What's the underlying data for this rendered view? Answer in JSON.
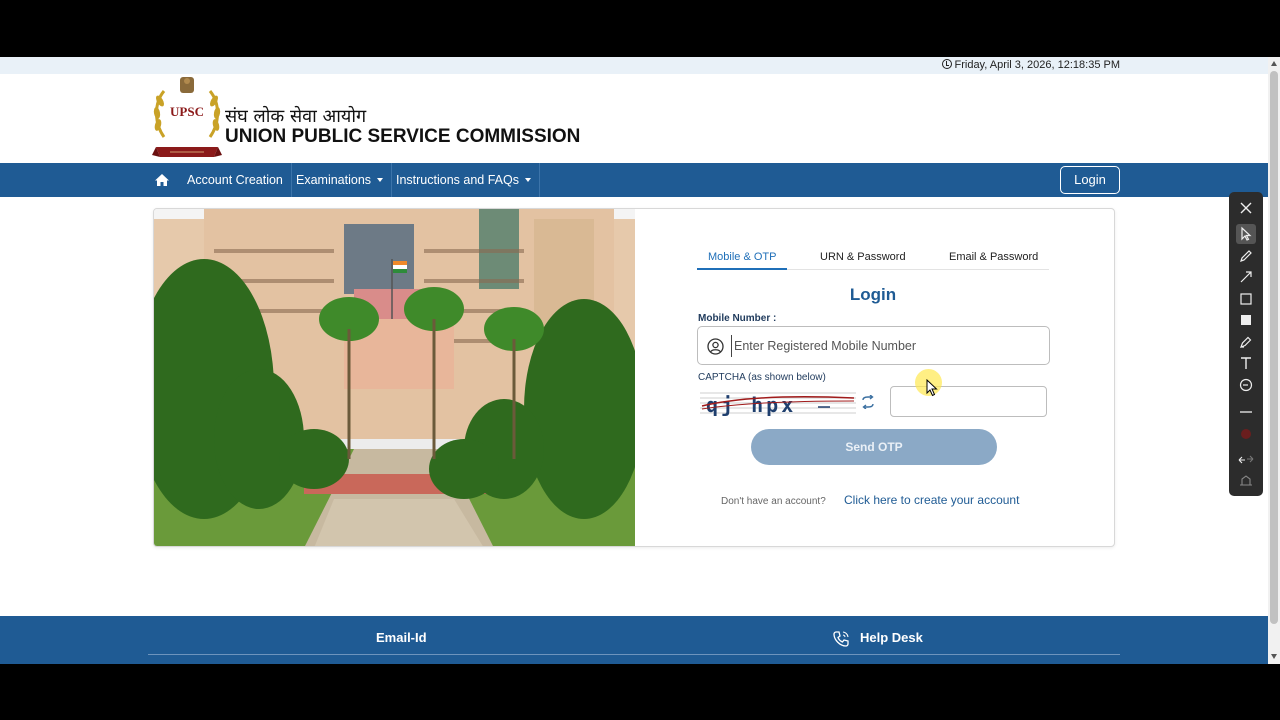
{
  "datetime": "Friday, April 3, 2026, 12:18:35 PM",
  "brand": {
    "emblem_text": "UPSC",
    "hindi_name": "संघ लोक सेवा आयोग",
    "english_name": "UNION PUBLIC SERVICE COMMISSION"
  },
  "nav": {
    "items": [
      {
        "label": "Account Creation"
      },
      {
        "label": "Examinations"
      },
      {
        "label": "Instructions and FAQs"
      }
    ],
    "login_label": "Login"
  },
  "login": {
    "tabs": [
      {
        "label": "Mobile & OTP",
        "active": true
      },
      {
        "label": "URN & Password",
        "active": false
      },
      {
        "label": "Email & Password",
        "active": false
      }
    ],
    "title": "Login",
    "mobile_label": "Mobile Number :",
    "mobile_placeholder": "Enter Registered Mobile Number",
    "captcha_label": "CAPTCHA (as shown below)",
    "captcha_text": "qj hpx",
    "send_otp_label": "Send OTP",
    "no_account_text": "Don't have an account?",
    "create_account_link": "Click here to create your account"
  },
  "footer": {
    "email_label": "Email-Id",
    "helpdesk_label": "Help Desk"
  },
  "colors": {
    "nav_blue": "#1f5b94",
    "button_disabled": "#8ba9c6",
    "link_blue": "#1f6fb8"
  }
}
